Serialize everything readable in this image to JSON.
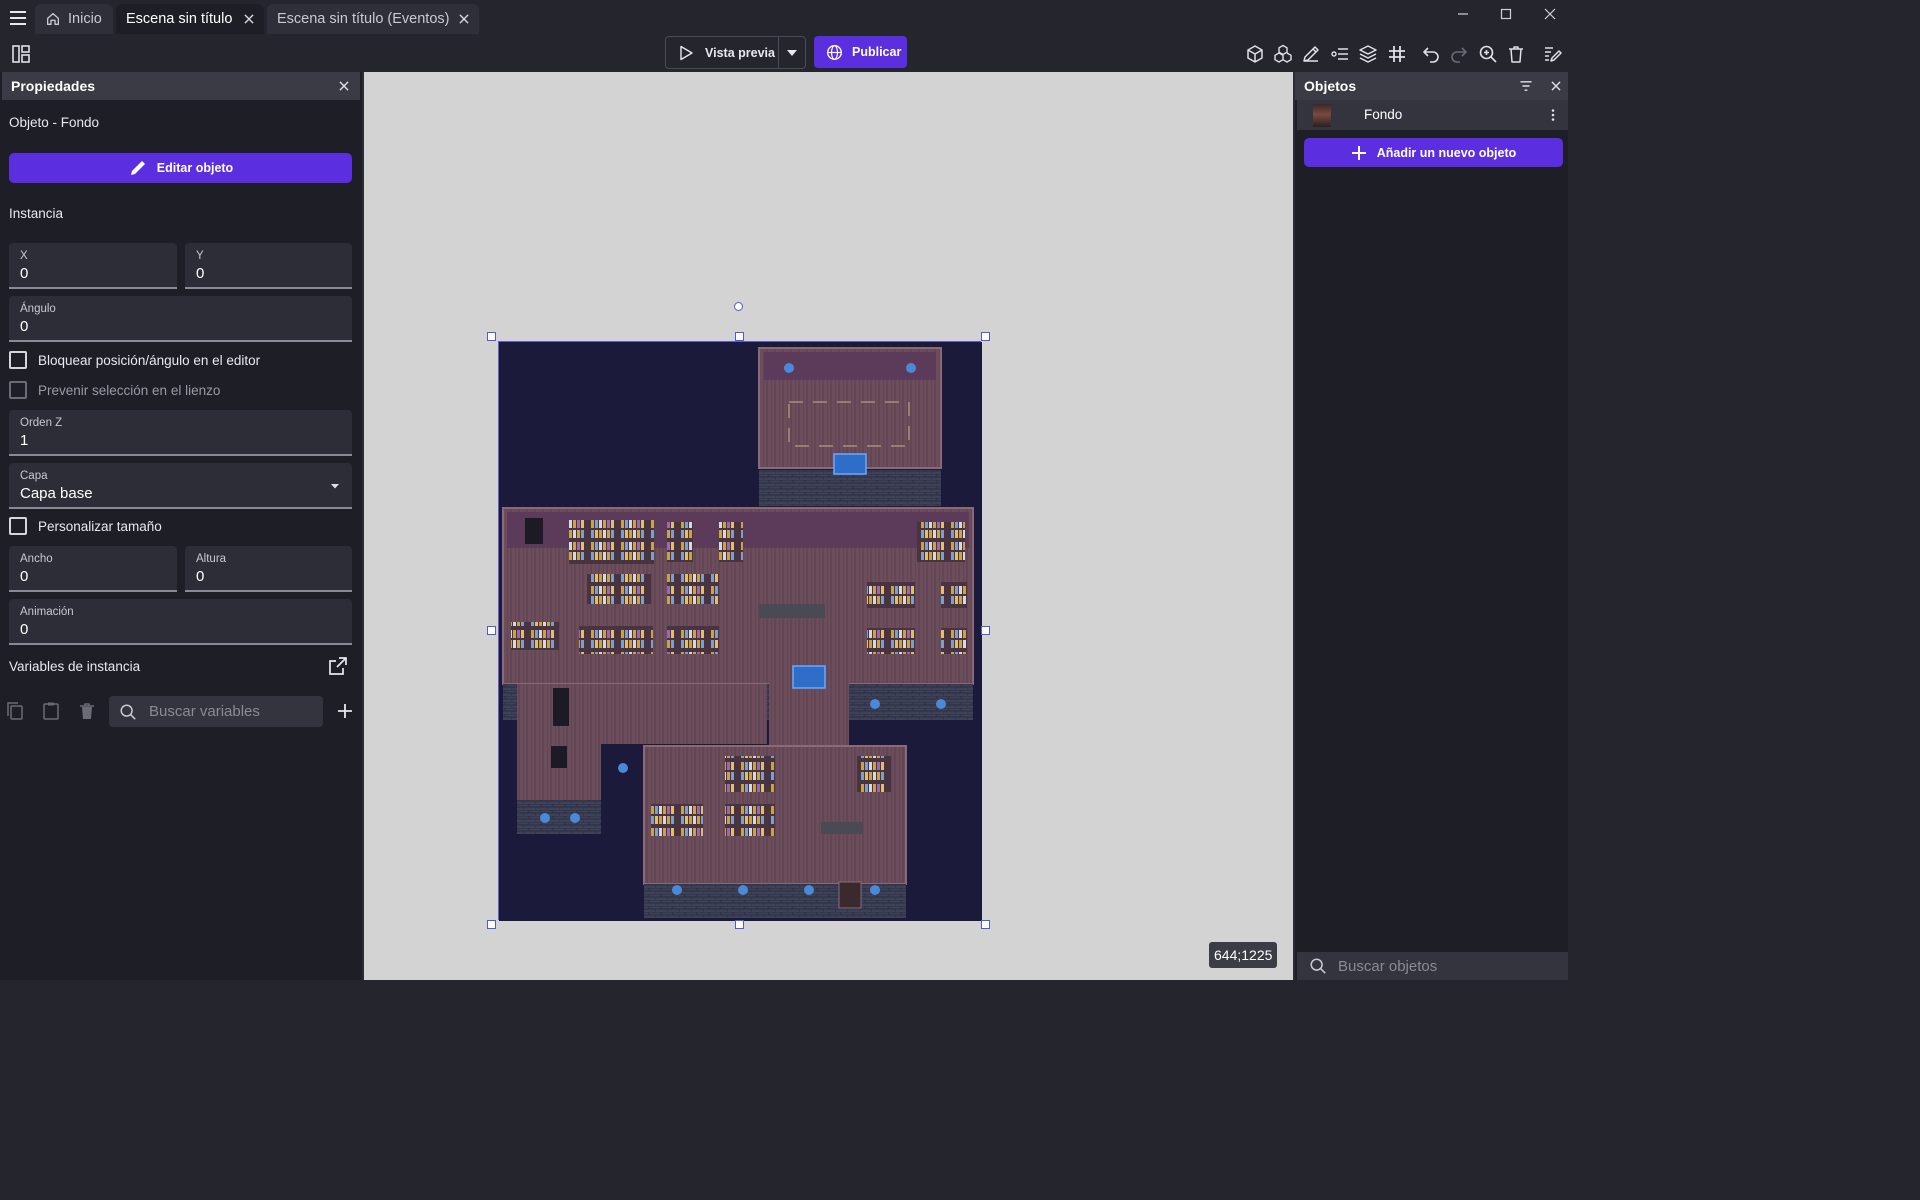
{
  "titlebar": {
    "tabs": [
      {
        "label": "Inicio",
        "icon": "home-icon"
      },
      {
        "label": "Escena sin título",
        "icon": "close-icon"
      },
      {
        "label": "Escena sin título (Eventos)",
        "icon": "close-icon"
      }
    ],
    "active_tab": "Escena sin título"
  },
  "toolbar": {
    "preview_label": "Vista previa",
    "publish_label": "Publicar",
    "icons": [
      "layout-panels-icon",
      "play-icon",
      "chevron-down-icon",
      "globe-icon",
      "cube-icon",
      "cubes-group-icon",
      "pencil-icon",
      "layer-list-icon",
      "layers-icon",
      "grid-icon",
      "undo-icon",
      "redo-icon",
      "zoom-icon",
      "trash-icon",
      "edit-scene-icon"
    ]
  },
  "properties_panel": {
    "title": "Propiedades",
    "object_label": "Objeto",
    "object_name": " - Fondo",
    "edit_object_label": "Editar objeto",
    "instance_label": "Instancia",
    "fields": {
      "x": {
        "label": "X",
        "value": "0"
      },
      "y": {
        "label": "Y",
        "value": "0"
      },
      "angle": {
        "label": "Ángulo",
        "value": "0"
      },
      "z_order": {
        "label": "Orden Z",
        "value": "1"
      },
      "layer": {
        "label": "Capa",
        "value": "Capa base"
      },
      "width": {
        "label": "Ancho",
        "value": "0"
      },
      "height": {
        "label": "Altura",
        "value": "0"
      },
      "animation": {
        "label": "Animación",
        "value": "0"
      }
    },
    "lock_label": "Bloquear posición/ángulo en el editor",
    "prevent_selection_label": "Prevenir selección en el lienzo",
    "custom_size_label": "Personalizar tamaño",
    "instance_variables_label": "Variables de instancia",
    "search_variables_placeholder": "Buscar variables"
  },
  "canvas": {
    "coordinates": "644;1225",
    "background_color": "#d3d3d3"
  },
  "objects_panel": {
    "title": "Objetos",
    "objects": [
      {
        "name": "Fondo"
      }
    ],
    "add_object_label": "Añadir un nuevo objeto",
    "search_placeholder": "Buscar objetos"
  },
  "colors": {
    "accent": "#5b2fe0",
    "panel_bg": "#1e1e26",
    "header_bg": "#3b3b46",
    "selection": "#4d5bd6"
  }
}
